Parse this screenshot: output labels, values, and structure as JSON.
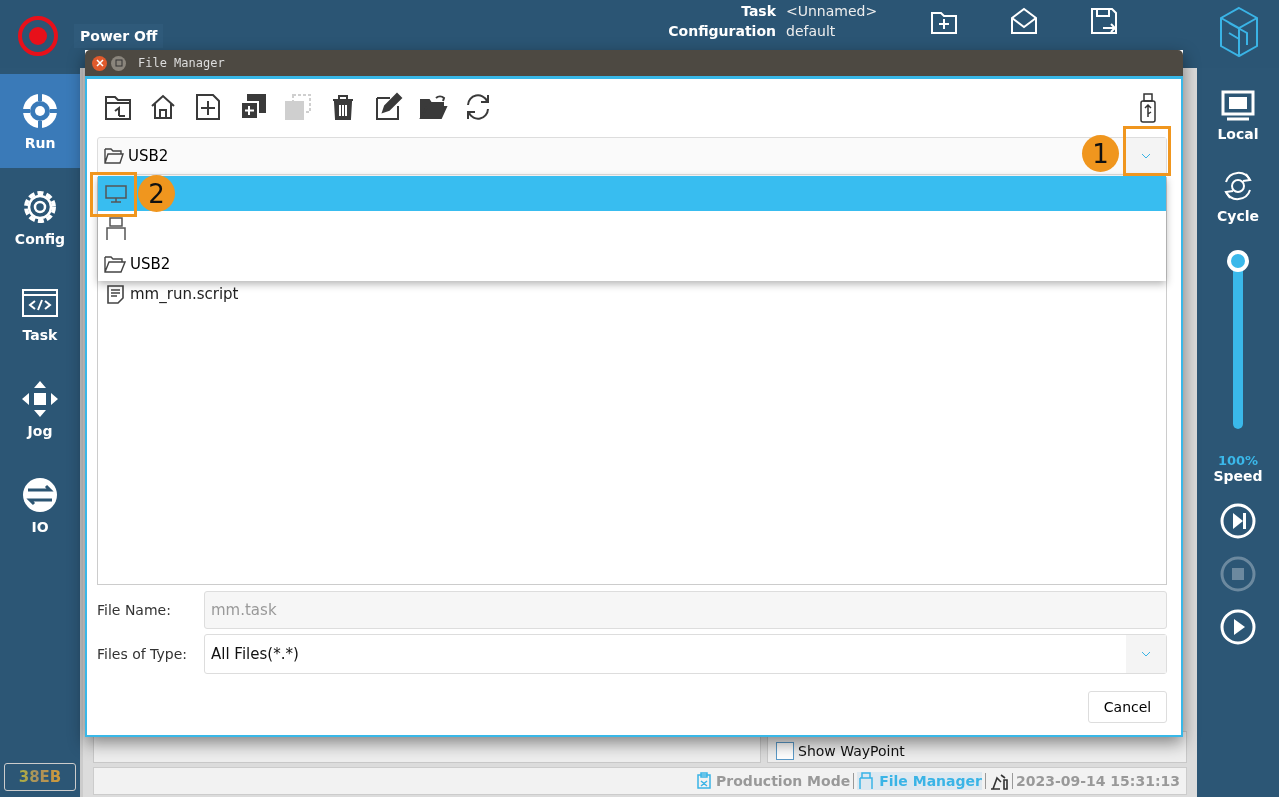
{
  "header": {
    "power_label": "Power Off",
    "task_label": "Task",
    "task_value": "<Unnamed>",
    "config_label": "Configuration",
    "config_value": "default",
    "actions": [
      {
        "kind": "new"
      },
      {
        "kind": "open"
      },
      {
        "kind": "save"
      }
    ]
  },
  "nav": [
    {
      "kind": "run",
      "label": "Run",
      "selected": true
    },
    {
      "kind": "config",
      "label": "Config",
      "selected": false
    },
    {
      "kind": "task",
      "label": "Task",
      "selected": false
    },
    {
      "kind": "jog",
      "label": "Jog",
      "selected": false
    },
    {
      "kind": "io",
      "label": "IO",
      "selected": false
    }
  ],
  "badge": "38EB",
  "right_panel": {
    "mode_label": "Local",
    "cycle_label": "Cycle",
    "speed": {
      "level": 1,
      "reading": "100%",
      "label": "Speed"
    },
    "controls": [
      {
        "kind": "step",
        "disabled": false
      },
      {
        "kind": "stop",
        "disabled": true
      },
      {
        "kind": "play",
        "disabled": false
      }
    ]
  },
  "background": {
    "show_waypoint": {
      "label": "Show WayPoint",
      "checked": false
    }
  },
  "status_bar": {
    "mode": "Production Mode",
    "file_manager": "File Manager",
    "datetime": "2023-09-14 15:31:13"
  },
  "dialog": {
    "title": "File Manager",
    "toolbar": [
      {
        "kind": "up",
        "disabled": false
      },
      {
        "kind": "home",
        "disabled": false
      },
      {
        "kind": "new-file",
        "disabled": false
      },
      {
        "kind": "copy",
        "disabled": false
      },
      {
        "kind": "paste",
        "disabled": true
      },
      {
        "kind": "delete",
        "disabled": false
      },
      {
        "kind": "rename",
        "disabled": false
      },
      {
        "kind": "open-folder",
        "disabled": false
      },
      {
        "kind": "refresh",
        "disabled": false
      }
    ],
    "location": "USB2",
    "location_options": [
      {
        "kind": "computer",
        "selected": true
      },
      {
        "kind": "usb",
        "selected": false
      },
      {
        "kind": "folder",
        "label": "USB2",
        "selected": false
      }
    ],
    "files": [
      {
        "kind": "script",
        "name": "mm_run.script"
      }
    ],
    "file_name_label": "File Name:",
    "file_name": "mm.task",
    "file_type_label": "Files of Type:",
    "file_type": "All Files(*.*)",
    "cancel": "Cancel"
  },
  "callouts": [
    {
      "kind": "dropdown",
      "number": "1"
    },
    {
      "kind": "computer",
      "number": "2"
    }
  ]
}
